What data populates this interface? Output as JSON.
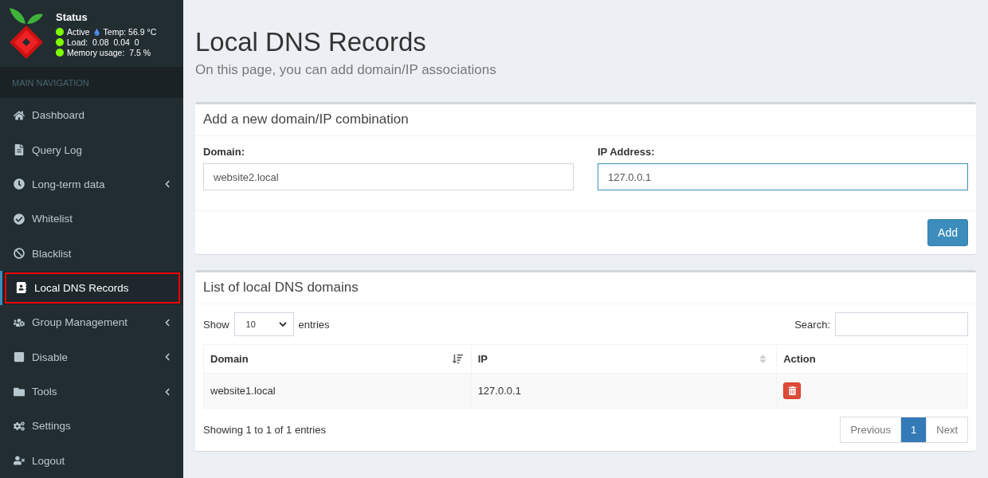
{
  "status": {
    "title": "Status",
    "lines": [
      {
        "text": "Active",
        "color": "#7fff00",
        "extra": "Temp: 56.9 °C"
      },
      {
        "text": "Load:  0.08  0.04  0",
        "color": "#7fff00"
      },
      {
        "text": "Memory usage:  7.5 %",
        "color": "#7fff00"
      }
    ]
  },
  "sidebar": {
    "header": "MAIN NAVIGATION",
    "items": [
      {
        "label": "Dashboard",
        "selected": false,
        "submenu": false
      },
      {
        "label": "Query Log",
        "selected": false,
        "submenu": false
      },
      {
        "label": "Long-term data",
        "selected": false,
        "submenu": true
      },
      {
        "label": "Whitelist",
        "selected": false,
        "submenu": false
      },
      {
        "label": "Blacklist",
        "selected": false,
        "submenu": false
      },
      {
        "label": "Local DNS Records",
        "selected": true,
        "submenu": false
      },
      {
        "label": "Group Management",
        "selected": false,
        "submenu": true
      },
      {
        "label": "Disable",
        "selected": false,
        "submenu": true
      },
      {
        "label": "Tools",
        "selected": false,
        "submenu": true
      },
      {
        "label": "Settings",
        "selected": false,
        "submenu": false
      },
      {
        "label": "Logout",
        "selected": false,
        "submenu": false
      }
    ]
  },
  "page": {
    "title": "Local DNS Records",
    "subtitle": "On this page, you can add domain/IP associations"
  },
  "add_box": {
    "title": "Add a new domain/IP combination",
    "fields": [
      {
        "label": "Domain:",
        "value": "website2.local",
        "focused": false
      },
      {
        "label": "IP Address:",
        "value": "127.0.0.1",
        "focused": true
      }
    ],
    "button": "Add"
  },
  "list_box": {
    "title": "List of local DNS domains",
    "show_label": "Show",
    "page_size": "10",
    "entries_label": "entries",
    "search_label": "Search:",
    "columns": [
      {
        "label": "Domain",
        "sortable": true,
        "sorted": true
      },
      {
        "label": "IP",
        "sortable": true,
        "sorted": false
      },
      {
        "label": "Action",
        "sortable": false
      }
    ],
    "rows": [
      {
        "domain": "website1.local",
        "ip": "127.0.0.1"
      }
    ],
    "info": "Showing 1 to 1 of 1 entries",
    "pagination": [
      {
        "label": "Previous",
        "selected": false
      },
      {
        "label": "1",
        "selected": true
      },
      {
        "label": "Next",
        "selected": false
      }
    ]
  }
}
